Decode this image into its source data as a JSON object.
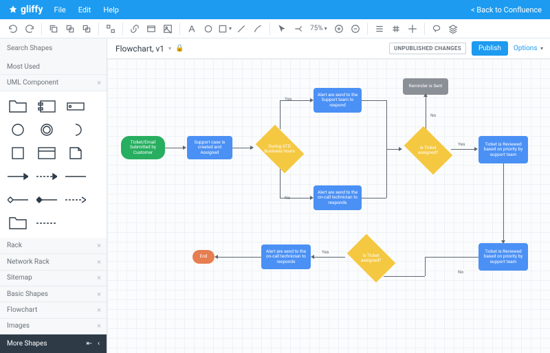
{
  "app": {
    "name": "gliffy"
  },
  "menu": {
    "file": "File",
    "edit": "Edit",
    "help": "Help"
  },
  "backlink": "< Back to Confluence",
  "zoom": "75%",
  "search": {
    "placeholder": "Search Shapes"
  },
  "doc": {
    "title": "Flowchart, v1"
  },
  "status": {
    "unpublished": "UNPUBLISHED CHANGES",
    "publish": "Publish",
    "options": "Options"
  },
  "cats": {
    "mostused": "Most Used",
    "umlcomp": "UML Component",
    "rack": "Rack",
    "networkrack": "Network Rack",
    "sitemap": "Sitemap",
    "basicshapes": "Basic Shapes",
    "flowchart": "Flowchart",
    "images": "Images"
  },
  "moreshapes": "More Shapes",
  "nodes": {
    "start": "Ticket/Email Submitted by Customer",
    "p1": "Support case is created and Assigned",
    "d1": "During STD Business hours",
    "p2": "Alert are send to the Support team to respond",
    "p3": "Alert are send to the on-call technician to responds",
    "reminder": "Reminder is Sent",
    "d2": "is Ticket assigned?",
    "p4": "Ticket is Reviewed based on priority by support team",
    "d3": "is Ticket assigned?",
    "p5": "Alert are send to the on-call technician to responds",
    "p6": "Ticket is Reviewed based on priority by support team",
    "end": "End"
  },
  "labels": {
    "yes": "Yes",
    "no": "No"
  }
}
